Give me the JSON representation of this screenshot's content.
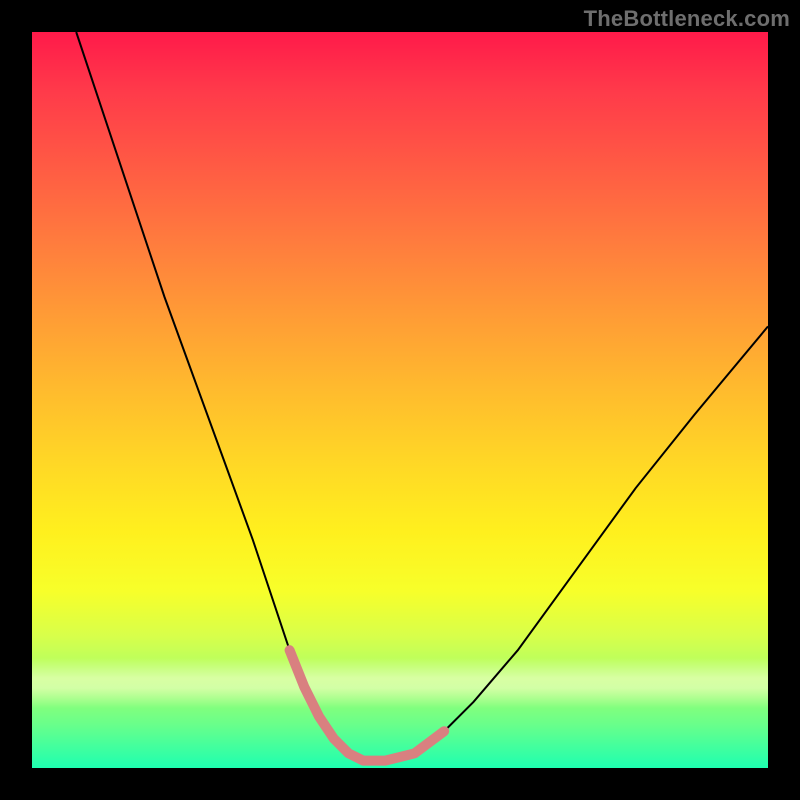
{
  "watermark": "TheBottleneck.com",
  "chart_data": {
    "type": "line",
    "title": "",
    "xlabel": "",
    "ylabel": "",
    "xlim": [
      0,
      100
    ],
    "ylim": [
      0,
      100
    ],
    "grid": false,
    "legend": false,
    "background_gradient_top_color": "#ff1a4a",
    "background_gradient_bottom_color": "#1effb0",
    "series": [
      {
        "name": "bottleneck-curve",
        "color": "#000000",
        "stroke_width": 2,
        "x": [
          6,
          10,
          14,
          18,
          22,
          26,
          30,
          33,
          35,
          37,
          39,
          41,
          43,
          45,
          48,
          52,
          56,
          60,
          66,
          74,
          82,
          90,
          100
        ],
        "values": [
          100,
          88,
          76,
          64,
          53,
          42,
          31,
          22,
          16,
          11,
          7,
          4,
          2,
          1,
          1,
          2,
          5,
          9,
          16,
          27,
          38,
          48,
          60
        ]
      },
      {
        "name": "highlight-valley",
        "color": "#d98080",
        "stroke_width": 10,
        "linecap": "round",
        "x": [
          35,
          37,
          39,
          41,
          43,
          45,
          48,
          50,
          52,
          54,
          56
        ],
        "values": [
          16,
          11,
          7,
          4,
          2,
          1,
          1,
          1.5,
          2,
          3.5,
          5
        ]
      }
    ],
    "annotations": []
  }
}
